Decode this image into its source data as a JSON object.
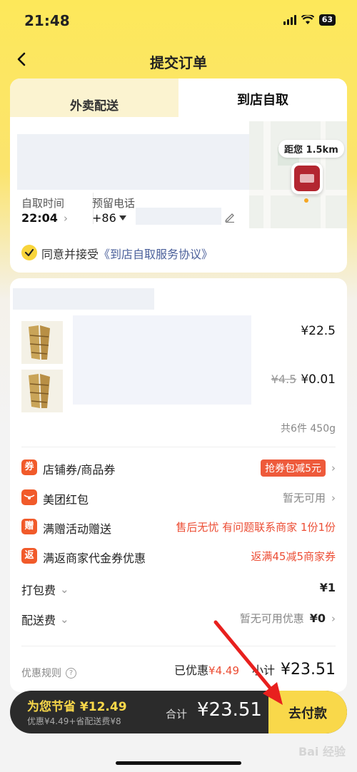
{
  "status": {
    "time": "21:48",
    "battery": "63"
  },
  "nav": {
    "title": "提交订单"
  },
  "tabs": {
    "delivery": "外卖配送",
    "pickup": "到店自取"
  },
  "pickup": {
    "distance": "距您 1.5km",
    "time_label": "自取时间",
    "time_value": "22:04",
    "phone_label": "预留电话",
    "phone_code": "+86"
  },
  "agreement": {
    "prefix": "同意并接受",
    "link": "《到店自取服务协议》"
  },
  "items": [
    {
      "price": "¥22.5"
    },
    {
      "original_price": "¥4.5",
      "price": "¥0.01"
    }
  ],
  "summary": {
    "count": "共6件 450g"
  },
  "rows": {
    "coupon": {
      "icon": "券",
      "label": "店铺券/商品券",
      "tag": "抢券包减5元"
    },
    "redpacket": {
      "icon_name": "red-packet-icon",
      "label": "美团红包",
      "value": "暂无可用"
    },
    "gift": {
      "icon": "赠",
      "label": "满赠活动赠送",
      "value": "售后无忧 有问题联系商家 1份1份"
    },
    "rebate": {
      "icon": "返",
      "label": "满返商家代金券优惠",
      "value": "返满45减5商家券"
    },
    "packing": {
      "label": "打包费",
      "value": "¥1"
    },
    "shipping": {
      "label": "配送费",
      "hint": "暂无可用优惠",
      "value": "¥0"
    }
  },
  "footer": {
    "rules": "优惠规则",
    "discount_label": "已优惠",
    "discount_value": "¥4.49",
    "subtotal_label": "小计",
    "subtotal_value": "¥23.51"
  },
  "bottom": {
    "save_title": "为您节省 ¥12.49",
    "save_sub": "优惠¥4.49+省配送费¥8",
    "total_label": "合计",
    "total_value": "¥23.51",
    "pay": "去付款"
  },
  "watermark": "Bai 经验",
  "colors": {
    "accent": "#f9d84a",
    "red": "#ec4e35",
    "dark": "#2b2b2b"
  }
}
